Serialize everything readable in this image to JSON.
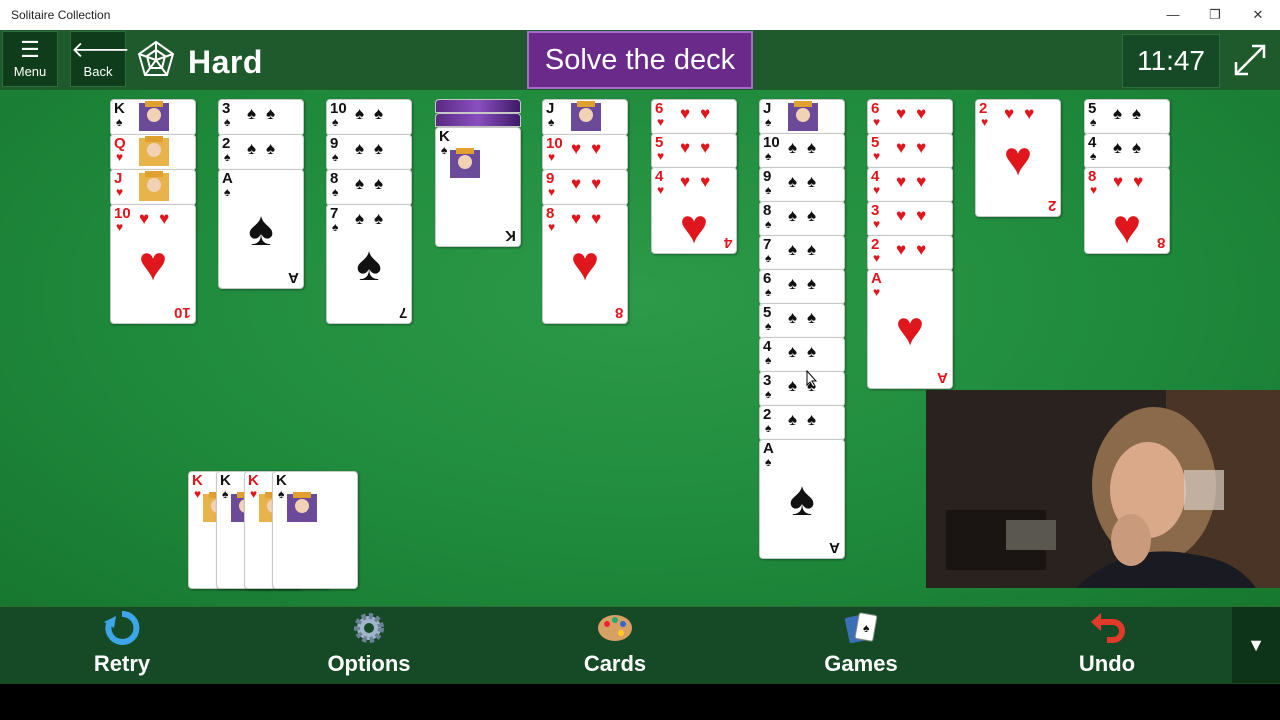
{
  "window": {
    "title": "Solitaire Collection",
    "minimize": "—",
    "restore": "❐",
    "close": "✕"
  },
  "topbar": {
    "menu_label": "Menu",
    "back_label": "Back",
    "difficulty": "Hard",
    "goal": "Solve the deck",
    "timer": "11:47"
  },
  "tableau": [
    {
      "cards": [
        "K♠",
        "Q♥",
        "J♥",
        "10♥"
      ]
    },
    {
      "cards": [
        "3♠",
        "2♠",
        "A♠"
      ]
    },
    {
      "cards": [
        "10♠",
        "9♠",
        "8♠",
        "7♠"
      ]
    },
    {
      "cards": [
        "K♠"
      ]
    },
    {
      "cards": [
        "J♠",
        "10♥",
        "9♥",
        "8♥"
      ]
    },
    {
      "cards": [
        "6♥",
        "5♥",
        "4♥"
      ]
    },
    {
      "cards": [
        "J♠",
        "10♠",
        "9♠",
        "8♠",
        "7♠",
        "6♠",
        "5♠",
        "4♠",
        "3♠",
        "2♠",
        "A♠"
      ]
    },
    {
      "cards": [
        "6♥",
        "5♥",
        "4♥",
        "3♥",
        "2♥",
        "A♥"
      ]
    },
    {
      "cards": [
        "2♥"
      ]
    },
    {
      "cards": [
        "5♠",
        "4♠",
        "8♥"
      ]
    }
  ],
  "foundation_kings": [
    "K♥",
    "K♠",
    "K♥",
    "K♠"
  ],
  "bottombar": {
    "retry": "Retry",
    "options": "Options",
    "cards": "Cards",
    "games": "Games",
    "undo": "Undo",
    "more": "▼"
  },
  "colors": {
    "felt": "#1f8a3c",
    "bar": "#164a27",
    "goal": "#6a2a8a",
    "red_suit": "#e0161d"
  }
}
